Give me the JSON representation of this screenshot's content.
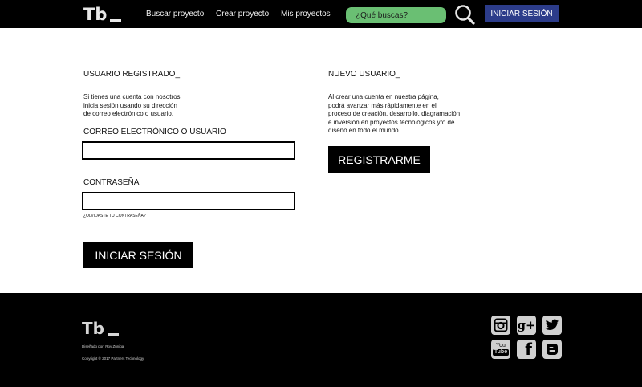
{
  "header": {
    "logo_text": "Tb",
    "nav": [
      "Buscar proyecto",
      "Crear proyecto",
      "Mis proyectos"
    ],
    "search_placeholder": "¿Qué buscas?",
    "login_label": "INICIAR SESIÓN"
  },
  "registered": {
    "title": "USUARIO REGISTRADO_",
    "intro_lines": [
      "Si tienes una cuenta con nosotros,",
      "inicia sesión usando su dirección",
      "de correo electrónico o usuario."
    ],
    "email_label": "CORREO ELECTRÓNICO O USUARIO",
    "email_value": "",
    "password_label": "CONTRASEÑA",
    "password_value": "",
    "forgot_label": "¿OLVIDASTE TU CONTRASEÑA?",
    "submit_label": "INICIAR SESIÓN"
  },
  "new_user": {
    "title": "NUEVO USUARIO_",
    "intro_lines": [
      "Al crear una cuenta en nuestra página,",
      "podrá avanzar más rápidamente en el",
      "proceso de creación, desarrollo, diagramación",
      "e inversión en proyectos tecnológicos y/o de",
      "diseño en todo el mundo."
    ],
    "register_label": "REGISTRARME"
  },
  "footer": {
    "logo_text": "Tb",
    "designed_by": "Diseñado por: Roy Zuniga",
    "copyright": "Copyright © 2017 Partners Technology",
    "social": [
      {
        "icon": "instagram-icon",
        "glyph": "◘"
      },
      {
        "icon": "google-plus-icon",
        "glyph": "g+"
      },
      {
        "icon": "twitter-icon",
        "glyph": "🐦"
      },
      {
        "icon": "youtube-icon",
        "glyph_top": "You",
        "glyph_bottom": "Tube"
      },
      {
        "icon": "facebook-icon",
        "glyph": "f"
      },
      {
        "icon": "blogger-icon",
        "glyph": "B"
      }
    ]
  },
  "colors": {
    "header_bg": "#000000",
    "search_bg": "#6abf73",
    "login_bg": "#2c3c8a",
    "social_bg": "#d0d0d0"
  }
}
